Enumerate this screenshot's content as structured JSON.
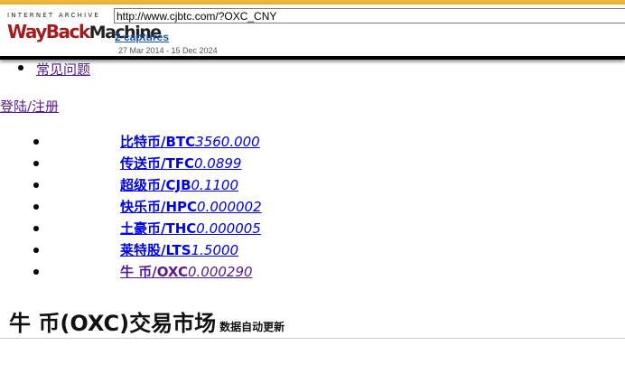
{
  "wayback": {
    "logo_top": "INTERNET ARCHIVE",
    "logo_way": "WayBack",
    "logo_machine": "Machine",
    "url": "http://www.cjbtc.com/?OXC_CNY",
    "captures": "2 captures",
    "date_range": "27 Mar 2014 - 15 Dec 2024",
    "brand_color": "#a31b1e",
    "accent_color": "#f0b63a"
  },
  "nav": {
    "faq": "常见问题",
    "login": "登陆/注册"
  },
  "coins": [
    {
      "name": "比特币/BTC",
      "price": "3560.000"
    },
    {
      "name": "传送币/TFC",
      "price": "0.0899"
    },
    {
      "name": "超级币/CJB",
      "price": "0.1100"
    },
    {
      "name": "快乐币/HPC",
      "price": "0.000002"
    },
    {
      "name": "土豪币/THC",
      "price": "0.000005"
    },
    {
      "name": "莱特股/LTS",
      "price": "1.5000"
    },
    {
      "name": "牛 币/OXC",
      "price": "0.000290"
    }
  ],
  "market": {
    "title": "牛 币(OXC)交易市场",
    "subtitle": "数据自动更新"
  },
  "colors": {
    "link": "#0000ee",
    "visited": "#551a8b"
  }
}
